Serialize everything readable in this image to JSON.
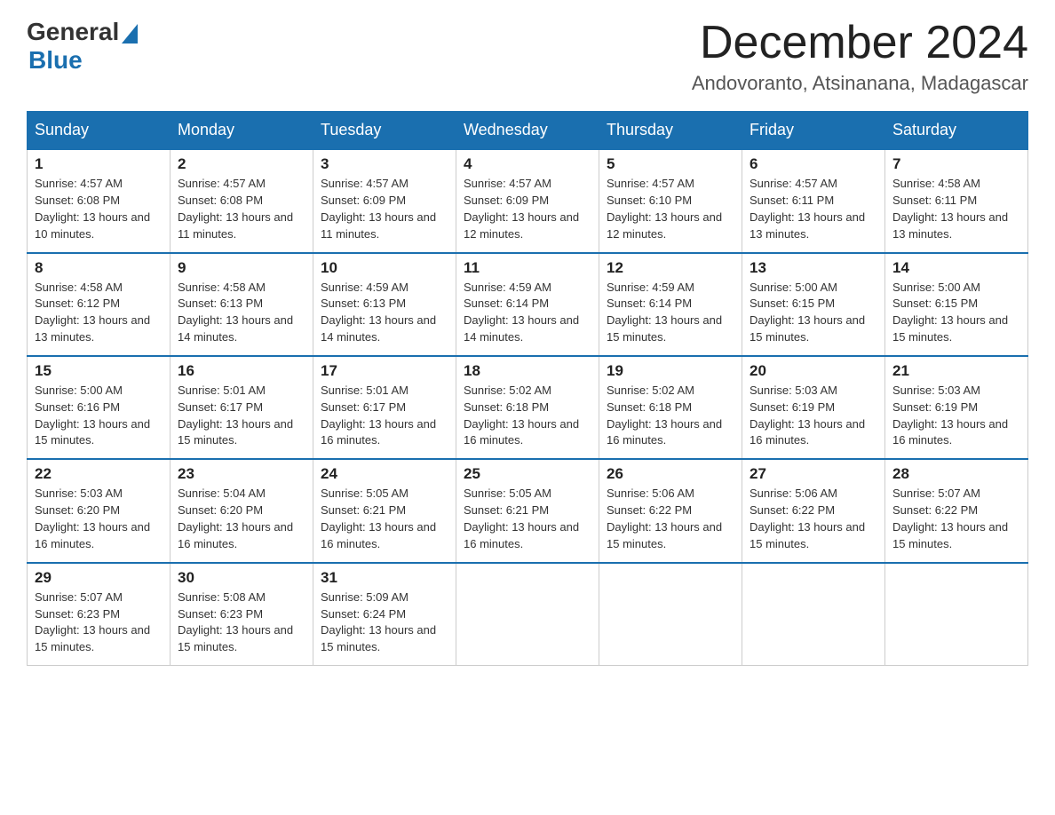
{
  "header": {
    "logo_general": "General",
    "logo_blue": "Blue",
    "title": "December 2024",
    "location": "Andovoranto, Atsinanana, Madagascar"
  },
  "days_of_week": [
    "Sunday",
    "Monday",
    "Tuesday",
    "Wednesday",
    "Thursday",
    "Friday",
    "Saturday"
  ],
  "weeks": [
    [
      {
        "num": "1",
        "sunrise": "4:57 AM",
        "sunset": "6:08 PM",
        "daylight": "13 hours and 10 minutes."
      },
      {
        "num": "2",
        "sunrise": "4:57 AM",
        "sunset": "6:08 PM",
        "daylight": "13 hours and 11 minutes."
      },
      {
        "num": "3",
        "sunrise": "4:57 AM",
        "sunset": "6:09 PM",
        "daylight": "13 hours and 11 minutes."
      },
      {
        "num": "4",
        "sunrise": "4:57 AM",
        "sunset": "6:09 PM",
        "daylight": "13 hours and 12 minutes."
      },
      {
        "num": "5",
        "sunrise": "4:57 AM",
        "sunset": "6:10 PM",
        "daylight": "13 hours and 12 minutes."
      },
      {
        "num": "6",
        "sunrise": "4:57 AM",
        "sunset": "6:11 PM",
        "daylight": "13 hours and 13 minutes."
      },
      {
        "num": "7",
        "sunrise": "4:58 AM",
        "sunset": "6:11 PM",
        "daylight": "13 hours and 13 minutes."
      }
    ],
    [
      {
        "num": "8",
        "sunrise": "4:58 AM",
        "sunset": "6:12 PM",
        "daylight": "13 hours and 13 minutes."
      },
      {
        "num": "9",
        "sunrise": "4:58 AM",
        "sunset": "6:13 PM",
        "daylight": "13 hours and 14 minutes."
      },
      {
        "num": "10",
        "sunrise": "4:59 AM",
        "sunset": "6:13 PM",
        "daylight": "13 hours and 14 minutes."
      },
      {
        "num": "11",
        "sunrise": "4:59 AM",
        "sunset": "6:14 PM",
        "daylight": "13 hours and 14 minutes."
      },
      {
        "num": "12",
        "sunrise": "4:59 AM",
        "sunset": "6:14 PM",
        "daylight": "13 hours and 15 minutes."
      },
      {
        "num": "13",
        "sunrise": "5:00 AM",
        "sunset": "6:15 PM",
        "daylight": "13 hours and 15 minutes."
      },
      {
        "num": "14",
        "sunrise": "5:00 AM",
        "sunset": "6:15 PM",
        "daylight": "13 hours and 15 minutes."
      }
    ],
    [
      {
        "num": "15",
        "sunrise": "5:00 AM",
        "sunset": "6:16 PM",
        "daylight": "13 hours and 15 minutes."
      },
      {
        "num": "16",
        "sunrise": "5:01 AM",
        "sunset": "6:17 PM",
        "daylight": "13 hours and 15 minutes."
      },
      {
        "num": "17",
        "sunrise": "5:01 AM",
        "sunset": "6:17 PM",
        "daylight": "13 hours and 16 minutes."
      },
      {
        "num": "18",
        "sunrise": "5:02 AM",
        "sunset": "6:18 PM",
        "daylight": "13 hours and 16 minutes."
      },
      {
        "num": "19",
        "sunrise": "5:02 AM",
        "sunset": "6:18 PM",
        "daylight": "13 hours and 16 minutes."
      },
      {
        "num": "20",
        "sunrise": "5:03 AM",
        "sunset": "6:19 PM",
        "daylight": "13 hours and 16 minutes."
      },
      {
        "num": "21",
        "sunrise": "5:03 AM",
        "sunset": "6:19 PM",
        "daylight": "13 hours and 16 minutes."
      }
    ],
    [
      {
        "num": "22",
        "sunrise": "5:03 AM",
        "sunset": "6:20 PM",
        "daylight": "13 hours and 16 minutes."
      },
      {
        "num": "23",
        "sunrise": "5:04 AM",
        "sunset": "6:20 PM",
        "daylight": "13 hours and 16 minutes."
      },
      {
        "num": "24",
        "sunrise": "5:05 AM",
        "sunset": "6:21 PM",
        "daylight": "13 hours and 16 minutes."
      },
      {
        "num": "25",
        "sunrise": "5:05 AM",
        "sunset": "6:21 PM",
        "daylight": "13 hours and 16 minutes."
      },
      {
        "num": "26",
        "sunrise": "5:06 AM",
        "sunset": "6:22 PM",
        "daylight": "13 hours and 15 minutes."
      },
      {
        "num": "27",
        "sunrise": "5:06 AM",
        "sunset": "6:22 PM",
        "daylight": "13 hours and 15 minutes."
      },
      {
        "num": "28",
        "sunrise": "5:07 AM",
        "sunset": "6:22 PM",
        "daylight": "13 hours and 15 minutes."
      }
    ],
    [
      {
        "num": "29",
        "sunrise": "5:07 AM",
        "sunset": "6:23 PM",
        "daylight": "13 hours and 15 minutes."
      },
      {
        "num": "30",
        "sunrise": "5:08 AM",
        "sunset": "6:23 PM",
        "daylight": "13 hours and 15 minutes."
      },
      {
        "num": "31",
        "sunrise": "5:09 AM",
        "sunset": "6:24 PM",
        "daylight": "13 hours and 15 minutes."
      },
      null,
      null,
      null,
      null
    ]
  ]
}
